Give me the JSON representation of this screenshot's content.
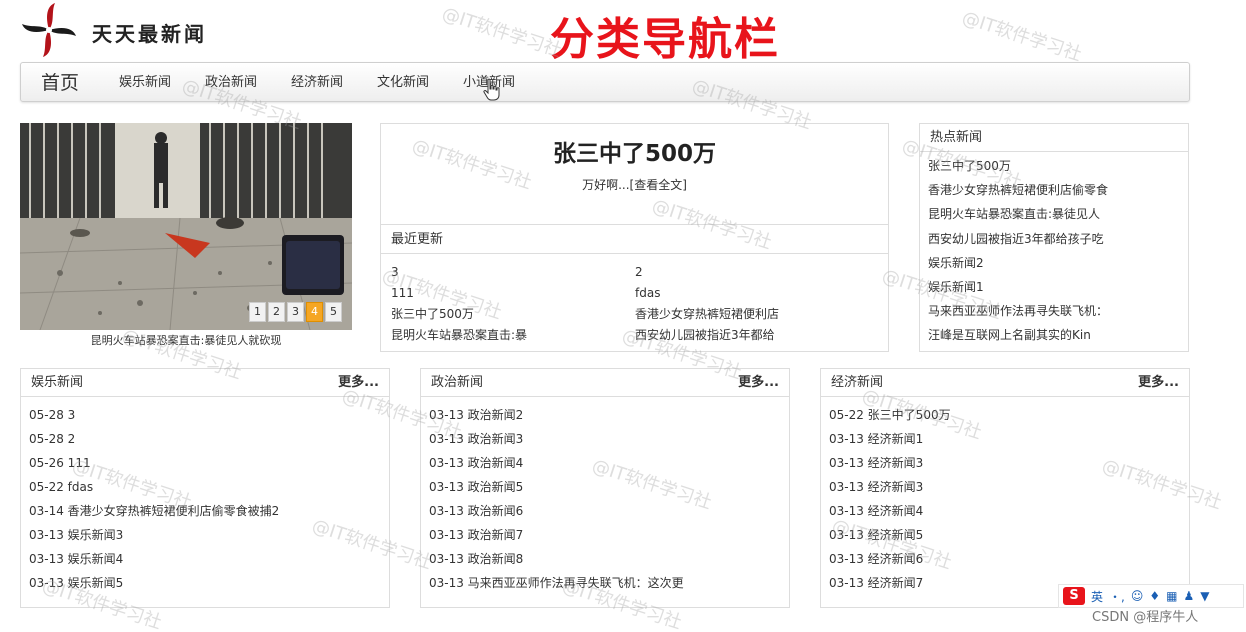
{
  "header": {
    "logo_text": "天天最新闻",
    "annotation": "分类导航栏"
  },
  "nav": {
    "home": "首页",
    "items": [
      "娱乐新闻",
      "政治新闻",
      "经济新闻",
      "文化新闻",
      "小道新闻"
    ]
  },
  "carousel": {
    "pages": [
      "1",
      "2",
      "3",
      "4",
      "5"
    ],
    "active_page": "4",
    "caption": "昆明火车站暴恐案直击:暴徒见人就砍现"
  },
  "headline": {
    "title": "张三中了500万",
    "summary": "万好啊...",
    "read_more": "[查看全文]"
  },
  "recent": {
    "title": "最近更新",
    "items": [
      "3",
      "2",
      "111",
      "fdas",
      "张三中了500万",
      "香港少女穿热裤短裙便利店",
      "昆明火车站暴恐案直击:暴",
      "西安幼儿园被指近3年都给"
    ]
  },
  "hot": {
    "title": "热点新闻",
    "items": [
      "张三中了500万",
      "香港少女穿热裤短裙便利店偷零食",
      "昆明火车站暴恐案直击:暴徒见人",
      "西安幼儿园被指近3年都给孩子吃",
      "娱乐新闻2",
      "娱乐新闻1",
      "马来西亚巫师作法再寻失联飞机：",
      "汪峰是互联网上名副其实的Kin"
    ]
  },
  "categories": [
    {
      "title": "娱乐新闻",
      "more": "更多...",
      "items": [
        "05-28 3",
        "05-28 2",
        "05-26 111",
        "05-22 fdas",
        "03-14 香港少女穿热裤短裙便利店偷零食被捕2",
        "03-13 娱乐新闻3",
        "03-13 娱乐新闻4",
        "03-13 娱乐新闻5"
      ]
    },
    {
      "title": "政治新闻",
      "more": "更多...",
      "items": [
        "03-13 政治新闻2",
        "03-13 政治新闻3",
        "03-13 政治新闻4",
        "03-13 政治新闻5",
        "03-13 政治新闻6",
        "03-13 政治新闻7",
        "03-13 政治新闻8",
        "03-13 马来西亚巫师作法再寻失联飞机：这次更"
      ]
    },
    {
      "title": "经济新闻",
      "more": "更多...",
      "items": [
        "05-22 张三中了500万",
        "03-13 经济新闻1",
        "03-13 经济新闻3",
        "03-13 经济新闻3",
        "03-13 经济新闻4",
        "03-13 经济新闻5",
        "03-13 经济新闻6",
        "03-13 经济新闻7"
      ]
    }
  ],
  "watermark": "@IT软件学习社",
  "ime": {
    "logo": "S",
    "label": "英"
  },
  "footer": "CSDN @程序牛人",
  "colors": {
    "annotation": "#e8141b",
    "active_page": "#f5a623",
    "border": "#dddddd"
  }
}
